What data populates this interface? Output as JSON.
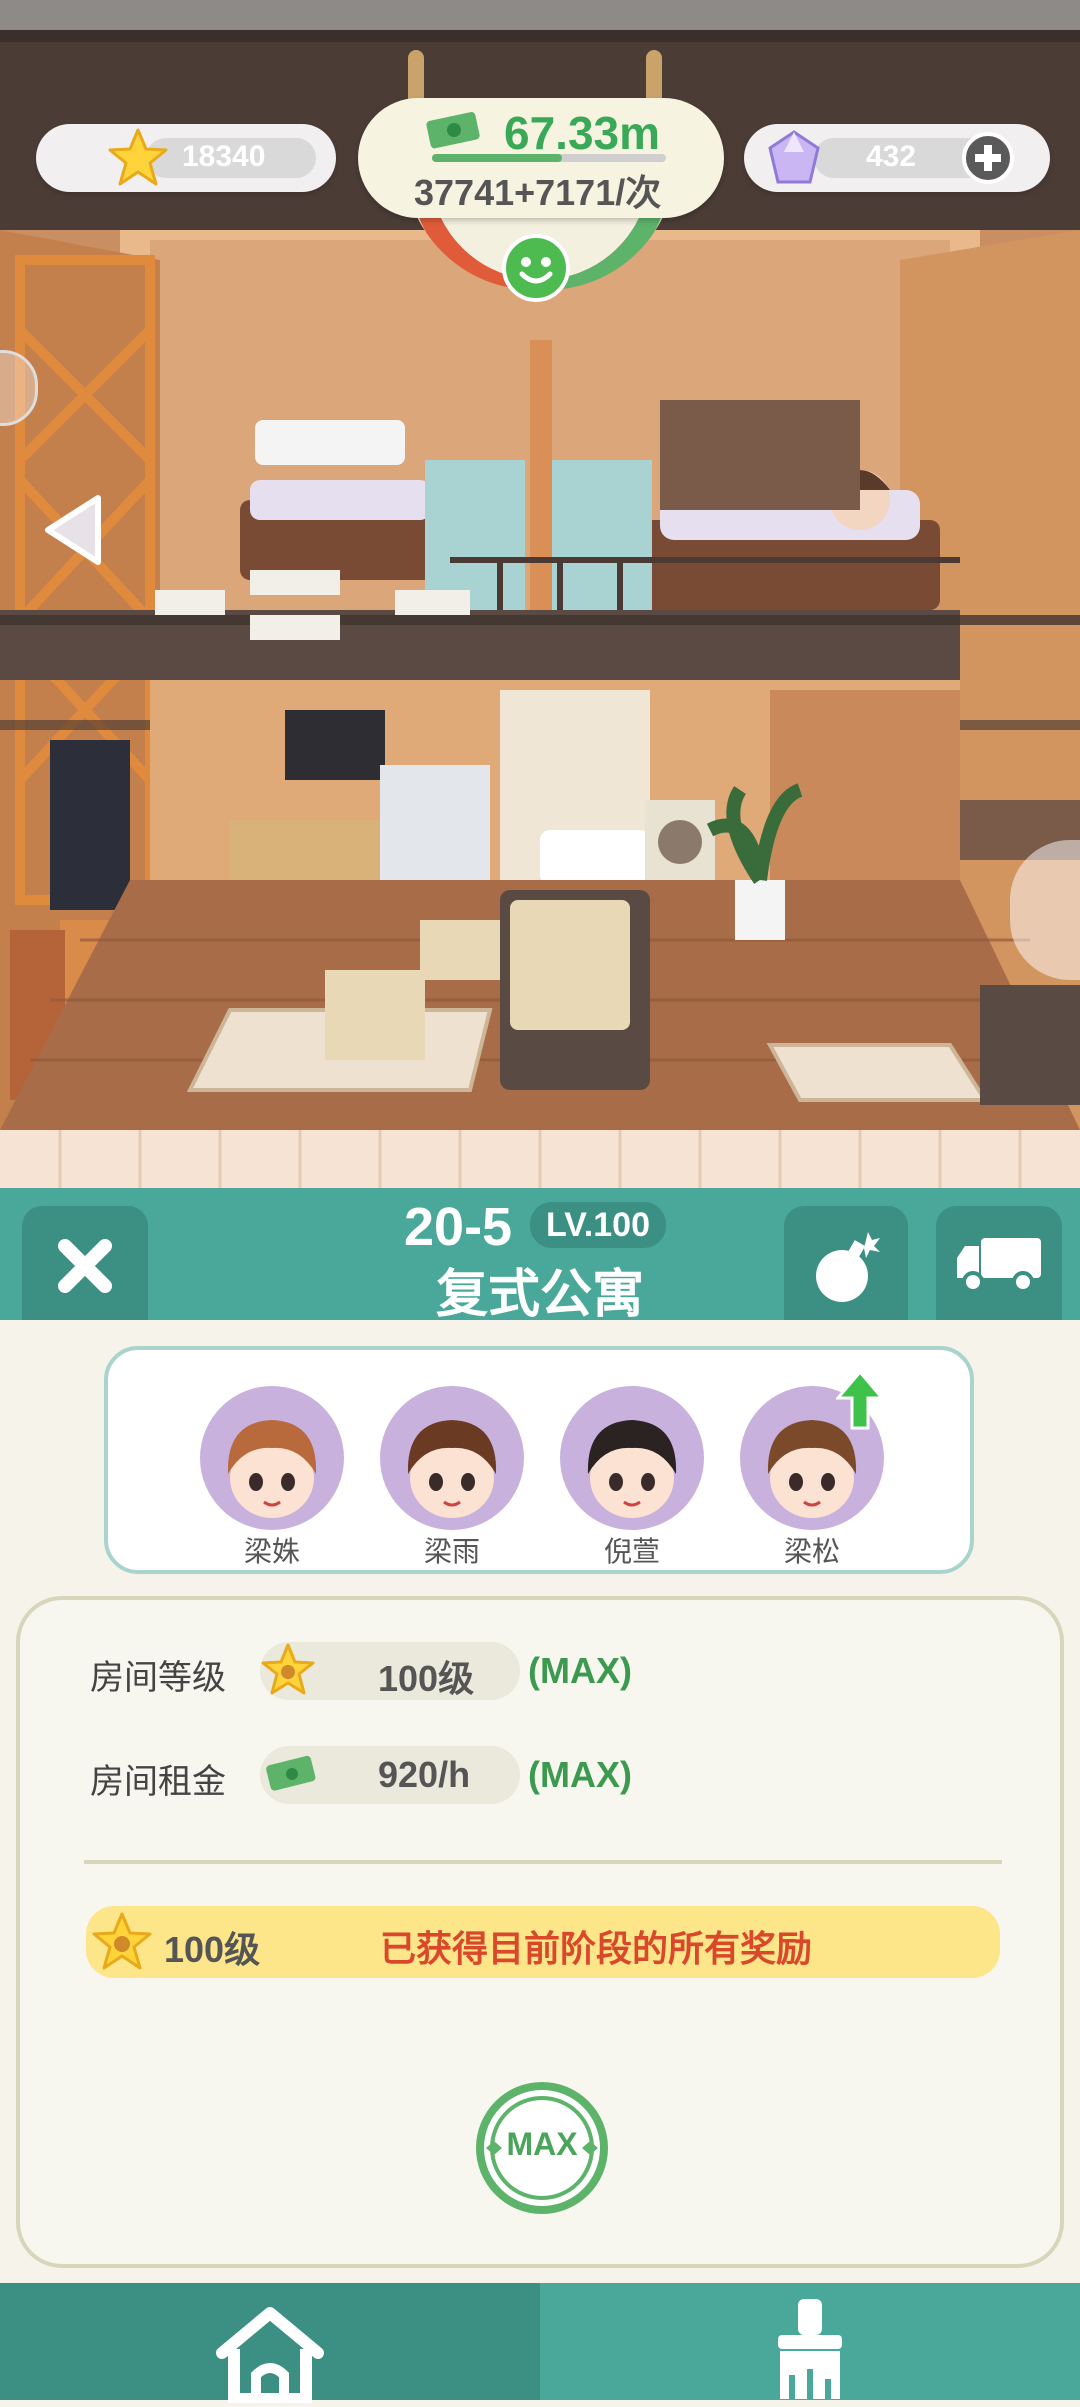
{
  "hud": {
    "stars": "18340",
    "money": "67.33m",
    "income": "37741+7171/次",
    "gems": "432"
  },
  "header": {
    "code": "20-5",
    "level_badge": "LV.100",
    "room_name": "复式公寓"
  },
  "characters": [
    {
      "name": "梁姝",
      "hair": "#b86a3c",
      "upgrade": false
    },
    {
      "name": "梁雨",
      "hair": "#6b3a22",
      "upgrade": false
    },
    {
      "name": "倪萱",
      "hair": "#2b2222",
      "upgrade": false
    },
    {
      "name": "梁松",
      "hair": "#7a4a2a",
      "upgrade": true
    }
  ],
  "stats": {
    "level_label": "房间等级",
    "level_value": "100级",
    "level_max": "(MAX)",
    "rent_label": "房间租金",
    "rent_value": "920/h",
    "rent_max": "(MAX)"
  },
  "reward": {
    "level": "100级",
    "text": "已获得目前阶段的所有奖励"
  },
  "max_badge": "MAX",
  "colors": {
    "teal": "#4aa89a",
    "teal_dark": "#3c8f83",
    "green_text": "#3b9a4f",
    "reward_bg": "#fde68a",
    "reward_text": "#d9482b"
  },
  "icons": [
    "star-icon",
    "cash-icon",
    "gem-icon",
    "plus-icon",
    "smiley-icon",
    "close-icon",
    "bomb-icon",
    "truck-icon",
    "home-icon",
    "paint-brush-icon",
    "upgrade-arrow-icon",
    "left-arrow-icon"
  ]
}
